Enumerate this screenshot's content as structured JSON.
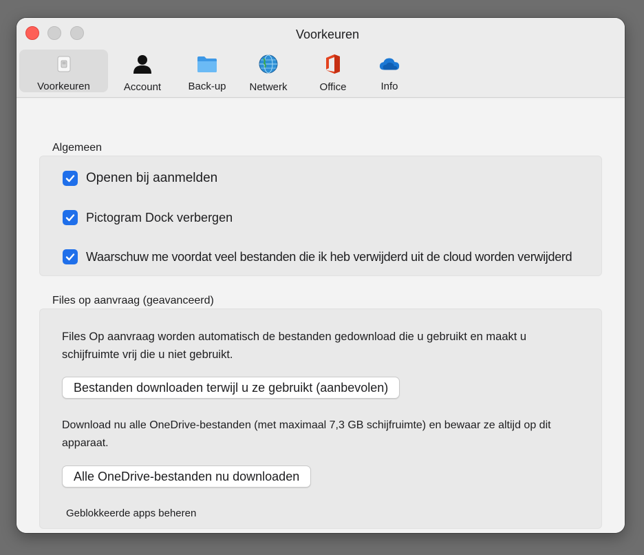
{
  "window": {
    "title": "Voorkeuren"
  },
  "tabs": [
    {
      "label": "Voorkeuren",
      "icon": "switch-icon",
      "selected": true
    },
    {
      "label": "Account",
      "icon": "person-icon",
      "selected": false
    },
    {
      "label": "Back-up",
      "icon": "folder-icon",
      "selected": false
    },
    {
      "label": "Netwerk",
      "icon": "globe-icon",
      "selected": false
    },
    {
      "label": "Office",
      "icon": "office-icon",
      "selected": false
    },
    {
      "label": "Info",
      "icon": "cloud-icon",
      "selected": false
    }
  ],
  "general": {
    "title": "Algemeen",
    "options": [
      {
        "label": "Openen bij aanmelden",
        "checked": true
      },
      {
        "label": "Pictogram Dock verbergen",
        "checked": true
      },
      {
        "label": "Waarschuw me voordat veel bestanden die ik heb verwijderd uit de cloud worden verwijderd",
        "checked": true
      }
    ]
  },
  "files_on_demand": {
    "title": "Files op aanvraag (geavanceerd)",
    "description_1": "Files Op aanvraag worden automatisch de bestanden gedownload die u gebruikt en maakt u schijfruimte vrij die u niet gebruikt.",
    "button_1": "Bestanden downloaden terwijl u ze gebruikt (aanbevolen)",
    "description_2": "Download nu alle OneDrive-bestanden (met maximaal 7,3 GB schijfruimte) en bewaar ze altijd op dit apparaat.",
    "button_2": "Alle OneDrive-bestanden nu downloaden",
    "link": "Geblokkeerde apps beheren"
  },
  "colors": {
    "accent": "#1f6fea",
    "close": "#fe5f57",
    "office_red": "#e3431f",
    "folder_blue": "#5aaef0",
    "cloud_blue": "#1b78d4"
  }
}
